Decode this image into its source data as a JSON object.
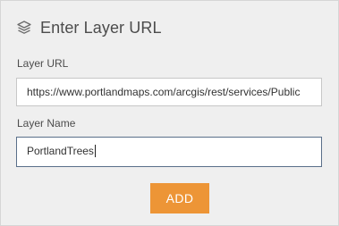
{
  "header": {
    "icon": "layers-icon",
    "title": "Enter Layer URL"
  },
  "layer_url": {
    "label": "Layer URL",
    "value": "https://www.portlandmaps.com/arcgis/rest/services/Public"
  },
  "layer_name": {
    "label": "Layer Name",
    "value": "PortlandTrees"
  },
  "actions": {
    "add_label": "ADD"
  },
  "colors": {
    "panel_background": "#efefef",
    "accent_button": "#ed9536",
    "focused_border": "#5a6f8a"
  }
}
